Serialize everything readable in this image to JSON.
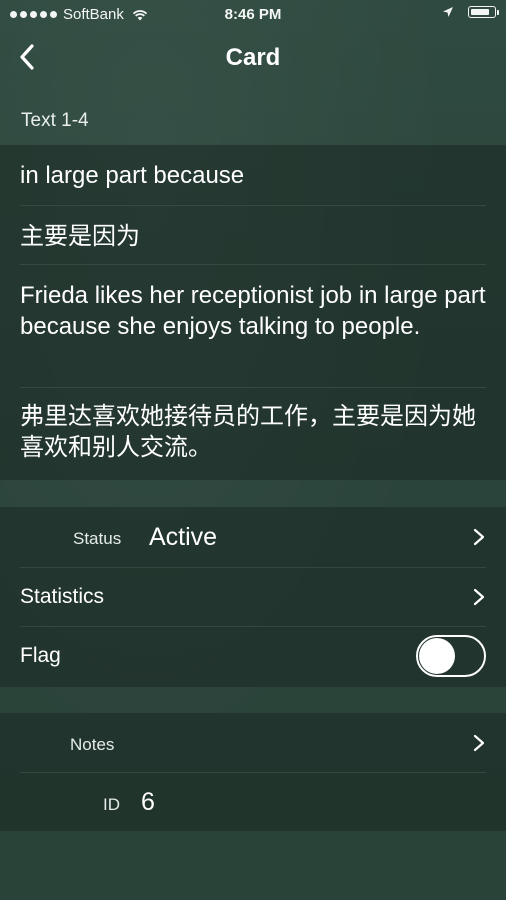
{
  "status_bar": {
    "carrier": "SoftBank",
    "time": "8:46 PM"
  },
  "nav": {
    "title": "Card",
    "back_icon": "chevron-left-icon"
  },
  "section": {
    "header": "Text 1-4"
  },
  "texts": [
    "in large part because",
    "主要是因为",
    "Frieda likes her receptionist job in large part because she enjoys talking to people.",
    "弗里达喜欢她接待员的工作，主要是因为她喜欢和别人交流。"
  ],
  "details": {
    "status_label": "Status",
    "status_value": "Active",
    "statistics_label": "Statistics",
    "flag_label": "Flag",
    "flag_on": false
  },
  "meta": {
    "notes_label": "Notes",
    "id_label": "ID",
    "id_value": "6"
  },
  "colors": {
    "background": "#2f4a40",
    "group_background": "#1a2822",
    "text": "#ffffff"
  }
}
